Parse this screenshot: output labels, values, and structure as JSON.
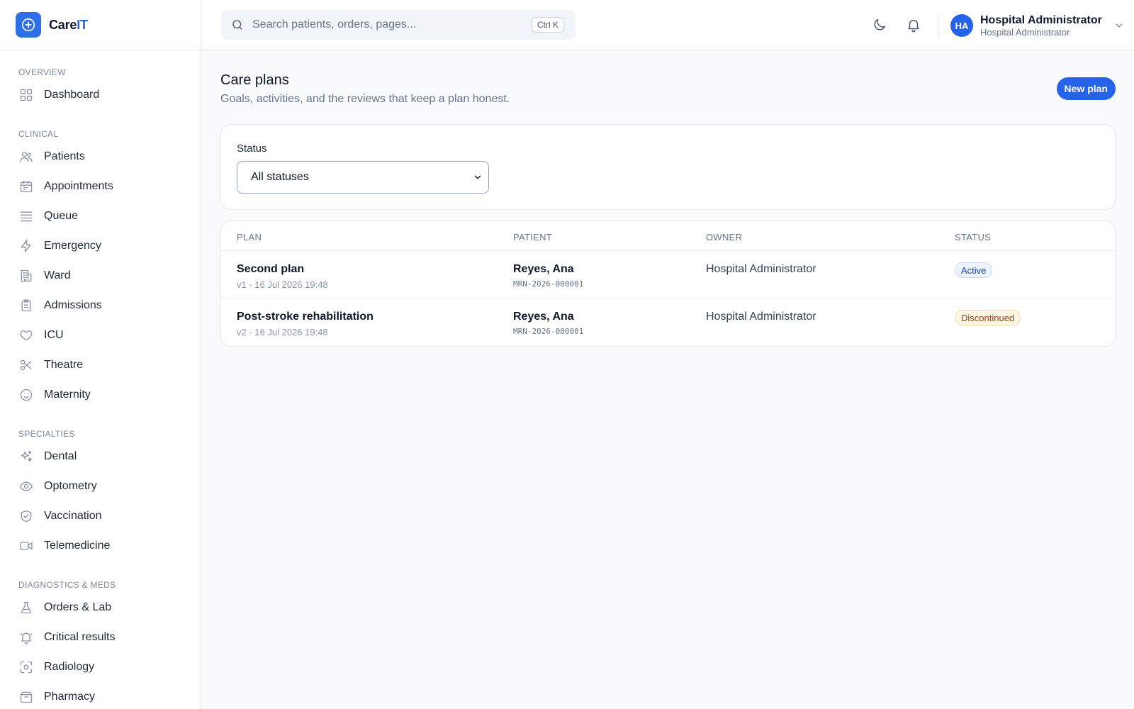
{
  "app": {
    "name_prefix": "Care",
    "name_suffix": "IT"
  },
  "sidebar": {
    "sections": [
      {
        "label": "OVERVIEW",
        "items": [
          {
            "label": "Dashboard",
            "icon": "grid-icon"
          }
        ]
      },
      {
        "label": "CLINICAL",
        "items": [
          {
            "label": "Patients",
            "icon": "users-icon"
          },
          {
            "label": "Appointments",
            "icon": "calendar-icon"
          },
          {
            "label": "Queue",
            "icon": "list-icon"
          },
          {
            "label": "Emergency",
            "icon": "lightning-icon"
          },
          {
            "label": "Ward",
            "icon": "building-icon"
          },
          {
            "label": "Admissions",
            "icon": "clipboard-icon"
          },
          {
            "label": "ICU",
            "icon": "heart-icon"
          },
          {
            "label": "Theatre",
            "icon": "scissors-icon"
          },
          {
            "label": "Maternity",
            "icon": "smile-icon"
          }
        ]
      },
      {
        "label": "SPECIALTIES",
        "items": [
          {
            "label": "Dental",
            "icon": "sparkles-icon"
          },
          {
            "label": "Optometry",
            "icon": "eye-icon"
          },
          {
            "label": "Vaccination",
            "icon": "shield-check-icon"
          },
          {
            "label": "Telemedicine",
            "icon": "video-icon"
          }
        ]
      },
      {
        "label": "DIAGNOSTICS & MEDS",
        "items": [
          {
            "label": "Orders & Lab",
            "icon": "flask-icon"
          },
          {
            "label": "Critical results",
            "icon": "bell-alert-icon"
          },
          {
            "label": "Radiology",
            "icon": "scan-icon"
          },
          {
            "label": "Pharmacy",
            "icon": "box-icon"
          }
        ]
      }
    ]
  },
  "topbar": {
    "search_placeholder": "Search patients, orders, pages...",
    "search_shortcut": "Ctrl K",
    "user_initials": "HA",
    "user_name": "Hospital Administrator",
    "user_role": "Hospital Administrator"
  },
  "page": {
    "title": "Care plans",
    "subtitle": "Goals, activities, and the reviews that keep a plan honest.",
    "new_button": "New plan"
  },
  "filter": {
    "label": "Status",
    "selected": "All statuses"
  },
  "table": {
    "headers": [
      "PLAN",
      "PATIENT",
      "OWNER",
      "STATUS"
    ],
    "rows": [
      {
        "plan": "Second plan",
        "meta": "v1 · 16 Jul 2026 19:48",
        "patient": "Reyes, Ana",
        "mrn": "MRN-2026-000001",
        "owner": "Hospital Administrator",
        "status": "Active",
        "status_kind": "active"
      },
      {
        "plan": "Post-stroke rehabilitation",
        "meta": "v2 · 16 Jul 2026 19:48",
        "patient": "Reyes, Ana",
        "mrn": "MRN-2026-000001",
        "owner": "Hospital Administrator",
        "status": "Discontinued",
        "status_kind": "discontinued"
      }
    ]
  },
  "colors": {
    "primary": "#2563eb",
    "active_badge": "#1e40af",
    "discontinued_badge": "#92400e"
  }
}
